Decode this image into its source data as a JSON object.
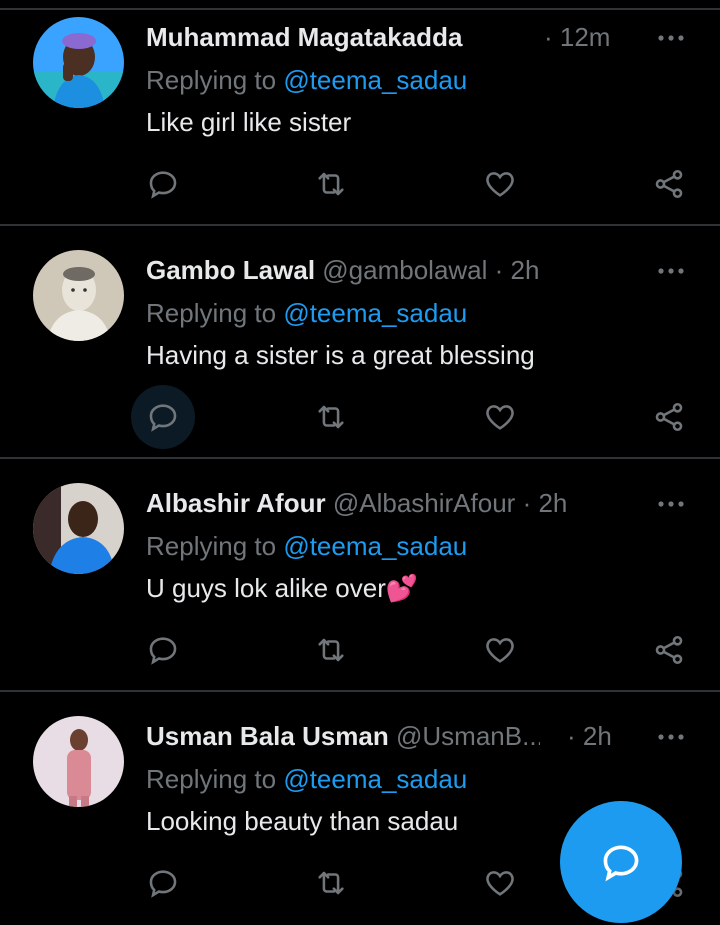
{
  "tweets": [
    {
      "name": "Muhammad Magatakadda",
      "handle": "@...",
      "time": "· 12m",
      "replying_prefix": "Replying to ",
      "replying_to": "@teema_sadau",
      "text": "Like girl like sister"
    },
    {
      "name": "Gambo Lawal",
      "handle": "@gambolawal",
      "time": "· 2h",
      "replying_prefix": "Replying to ",
      "replying_to": "@teema_sadau",
      "text": "Having a sister is a great blessing"
    },
    {
      "name": "Albashir Afour",
      "handle": "@AlbashirAfour",
      "time": "· 2h",
      "replying_prefix": "Replying to ",
      "replying_to": "@teema_sadau",
      "text": "U guys lok alike over💕"
    },
    {
      "name": "Usman Bala Usman",
      "handle": "@UsmanB...",
      "time": "· 2h",
      "replying_prefix": "Replying to ",
      "replying_to": "@teema_sadau",
      "text": "Looking beauty than sadau"
    }
  ],
  "colors": {
    "accent": "#1d9bf0",
    "muted": "#71767b",
    "text": "#e7e9ea",
    "divider": "#2f3336"
  },
  "icons": {
    "reply": "speech-bubble-icon",
    "retweet": "retweet-icon",
    "like": "heart-icon",
    "share": "share-icon",
    "more": "more-dots-icon",
    "compose": "compose-reply-icon"
  }
}
